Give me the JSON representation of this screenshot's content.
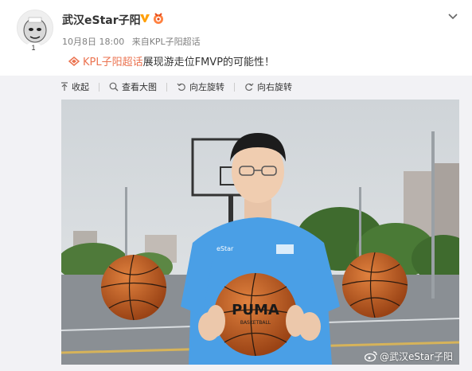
{
  "post": {
    "author_name": "武汉eStar子阳",
    "avatar_badge": "1",
    "date": "10月8日 18:00",
    "source": "来自KPL子阳超话",
    "topic_link": "KPL子阳超话",
    "content_text": "展现游走位FMVP的可能性！"
  },
  "toolbar": {
    "collapse": "收起",
    "view_large": "查看大图",
    "rotate_left": "向左旋转",
    "rotate_right": "向右旋转"
  },
  "photo": {
    "jersey_text": "eStar",
    "ball_text": "PUMA",
    "ball_subtext": "BASKETBALL",
    "watermark": "@武汉eStar子阳"
  },
  "colors": {
    "accent": "#eb7350",
    "verified": "#ffa00a",
    "jersey": "#4a9fe6"
  }
}
